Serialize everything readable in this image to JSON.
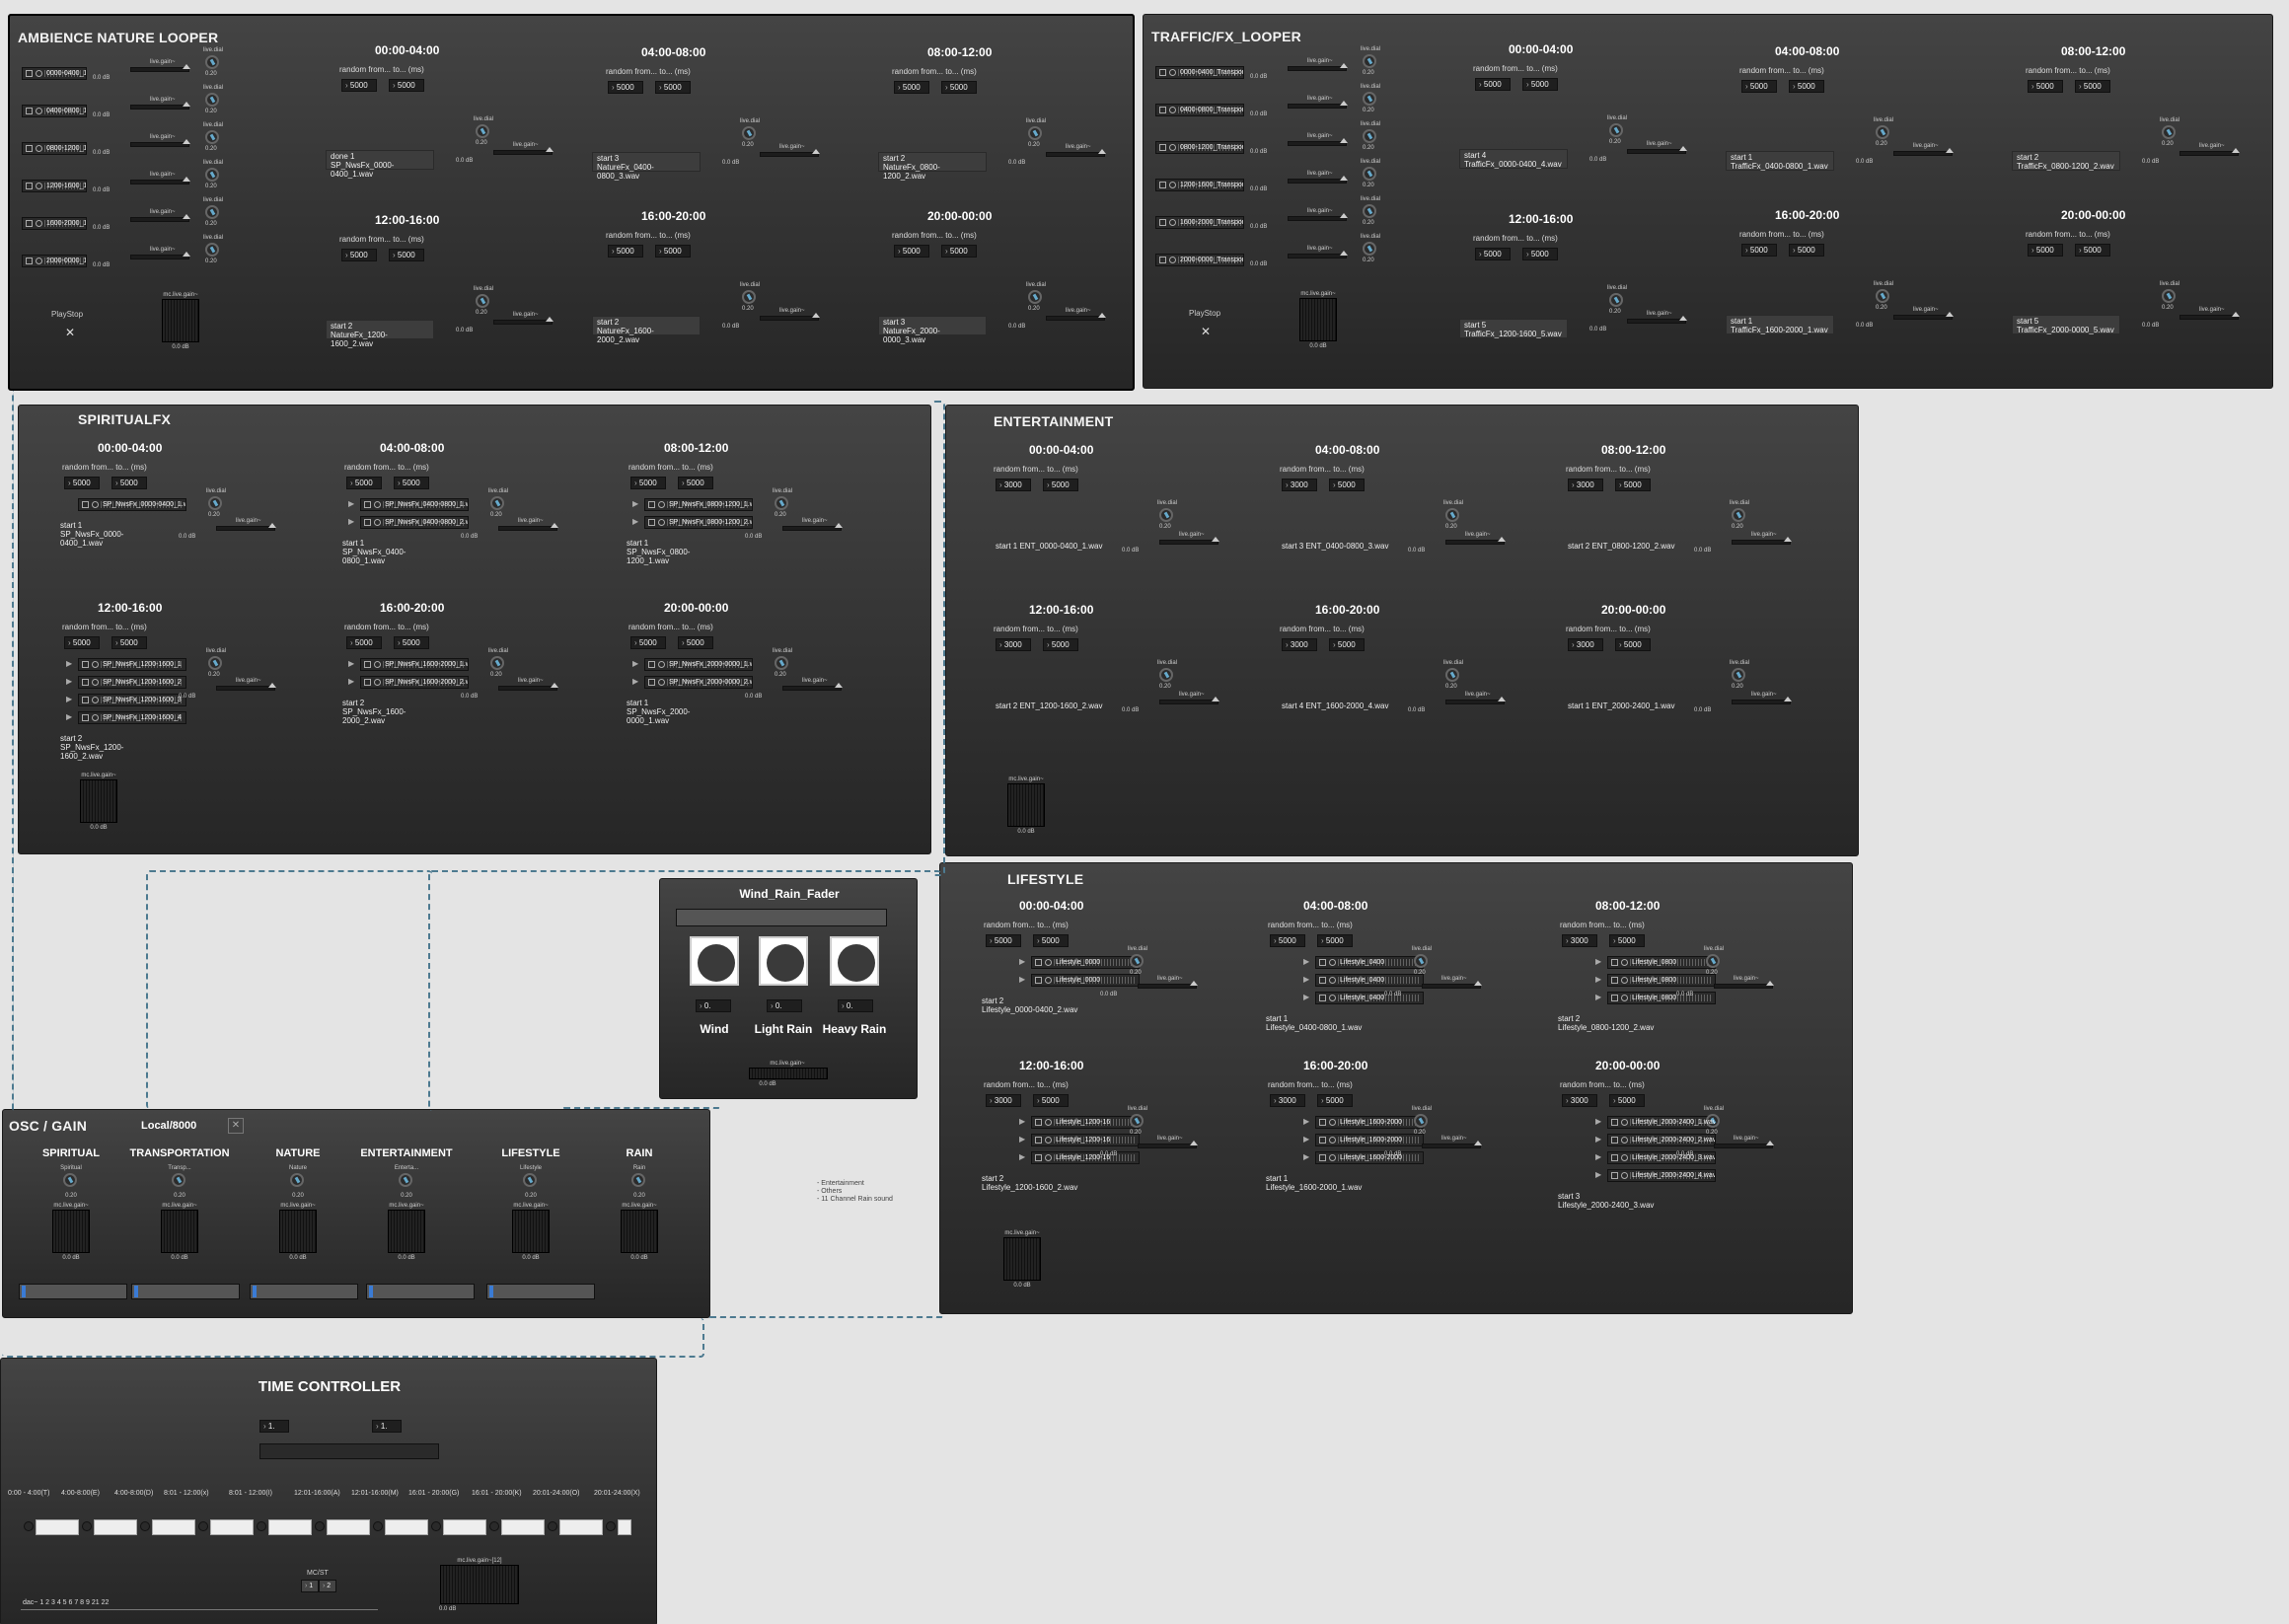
{
  "ambience": {
    "title": "AMBIENCE NATURE LOOPER",
    "play_label": "PlayStop",
    "slots": [
      {
        "time": "00:00-04:00",
        "min": "5000",
        "max": "5000",
        "status_a": "done 1",
        "status_b": "SP_NwsFx_0000-0400_1.wav"
      },
      {
        "time": "04:00-08:00",
        "min": "5000",
        "max": "5000",
        "status_a": "start 3",
        "status_b": "NatureFx_0400-0800_3.wav"
      },
      {
        "time": "08:00-12:00",
        "min": "5000",
        "max": "5000",
        "status_a": "start 2",
        "status_b": "NatureFx_0800-1200_2.wav"
      },
      {
        "time": "12:00-16:00",
        "min": "5000",
        "max": "5000",
        "status_a": "start 2",
        "status_b": "NatureFx_1200-1600_2.wav"
      },
      {
        "time": "16:00-20:00",
        "min": "5000",
        "max": "5000",
        "status_a": "start 2",
        "status_b": "NatureFx_1600-2000_2.wav"
      },
      {
        "time": "20:00-00:00",
        "min": "5000",
        "max": "5000",
        "status_a": "start 3",
        "status_b": "NatureFx_2000-0000_3.wav"
      }
    ],
    "waves": [
      "0000-0400_1",
      "0400-0800_1",
      "0800-1200_1",
      "1200-1600_1",
      "1600-2000_1",
      "2000-0000_1"
    ]
  },
  "traffic": {
    "title": "TRAFFIC/FX_LOOPER",
    "play_label": "PlayStop",
    "slots": [
      {
        "time": "00:00-04:00",
        "min": "5000",
        "max": "5000",
        "status_a": "start 4",
        "status_b": "TrafficFx_0000-0400_4.wav"
      },
      {
        "time": "04:00-08:00",
        "min": "5000",
        "max": "5000",
        "status_a": "start 1",
        "status_b": "TrafficFx_0400-0800_1.wav"
      },
      {
        "time": "08:00-12:00",
        "min": "5000",
        "max": "5000",
        "status_a": "start 2",
        "status_b": "TrafficFx_0800-1200_2.wav"
      },
      {
        "time": "12:00-16:00",
        "min": "5000",
        "max": "5000",
        "status_a": "start 5",
        "status_b": "TrafficFx_1200-1600_5.wav"
      },
      {
        "time": "16:00-20:00",
        "min": "5000",
        "max": "5000",
        "status_a": "start 1",
        "status_b": "TrafficFx_1600-2000_1.wav"
      },
      {
        "time": "20:00-00:00",
        "min": "5000",
        "max": "5000",
        "status_a": "start 5",
        "status_b": "TrafficFx_2000-0000_5.wav"
      }
    ],
    "waves": [
      "0000-0400_Transport",
      "0400-0800_Transport",
      "0800-1200_Transport",
      "1200-1600_Transport",
      "1600-2000_Transport",
      "2000-0000_Transport"
    ]
  },
  "spiritual": {
    "title": "SPIRITUALFX",
    "slots": [
      {
        "time": "00:00-04:00",
        "min": "5000",
        "max": "5000",
        "status_a": "start 1",
        "status_b": "SP_NwsFx_0000-0400_1.wav",
        "waves": [
          "SP_NwsFx_0000-0400_1.wav"
        ]
      },
      {
        "time": "04:00-08:00",
        "min": "5000",
        "max": "5000",
        "status_a": "start 1",
        "status_b": "SP_NwsFx_0400-0800_1.wav",
        "waves": [
          "SP_NwsFx_0400-0800_1.wav",
          "SP_NwsFx_0400-0800_2.wav"
        ]
      },
      {
        "time": "08:00-12:00",
        "min": "5000",
        "max": "5000",
        "status_a": "start 1",
        "status_b": "SP_NwsFx_0800-1200_1.wav",
        "waves": [
          "SP_NwsFx_0800-1200_1.wav",
          "SP_NwsFx_0800-1200_2.wav"
        ]
      },
      {
        "time": "12:00-16:00",
        "min": "5000",
        "max": "5000",
        "status_a": "start 2",
        "status_b": "SP_NwsFx_1200-1600_2.wav",
        "waves": [
          "SP_NwsFx_1200-1600_1",
          "SP_NwsFx_1200-1600_2",
          "SP_NwsFx_1200-1600_3",
          "SP_NwsFx_1200-1600_4"
        ]
      },
      {
        "time": "16:00-20:00",
        "min": "5000",
        "max": "5000",
        "status_a": "start 2",
        "status_b": "SP_NwsFx_1600-2000_2.wav",
        "waves": [
          "SP_NwsFx_1600-2000_1.wav",
          "SP_NwsFx_1600-2000_2.wav"
        ]
      },
      {
        "time": "20:00-00:00",
        "min": "5000",
        "max": "5000",
        "status_a": "start 1",
        "status_b": "SP_NwsFx_2000-0000_1.wav",
        "waves": [
          "SP_NwsFx_2000-0000_1.wav",
          "SP_NwsFx_2000-0000_2.wav"
        ]
      }
    ]
  },
  "entertainment": {
    "title": "ENTERTAINMENT",
    "slots": [
      {
        "time": "00:00-04:00",
        "min": "3000",
        "max": "5000",
        "status": "start 1 ENT_0000-0400_1.wav"
      },
      {
        "time": "04:00-08:00",
        "min": "3000",
        "max": "5000",
        "status": "start 3 ENT_0400-0800_3.wav"
      },
      {
        "time": "08:00-12:00",
        "min": "3000",
        "max": "5000",
        "status": "start 2 ENT_0800-1200_2.wav"
      },
      {
        "time": "12:00-16:00",
        "min": "3000",
        "max": "5000",
        "status": "start 2 ENT_1200-1600_2.wav"
      },
      {
        "time": "16:00-20:00",
        "min": "3000",
        "max": "5000",
        "status": "start 4 ENT_1600-2000_4.wav"
      },
      {
        "time": "20:00-00:00",
        "min": "3000",
        "max": "5000",
        "status": "start 1 ENT_2000-2400_1.wav"
      }
    ]
  },
  "lifestyle": {
    "title": "LIFESTYLE",
    "slots": [
      {
        "time": "00:00-04:00",
        "min": "5000",
        "max": "5000",
        "status_a": "start 2",
        "status_b": "Lifestyle_0000-0400_2.wav",
        "waves": [
          "Lifestyle_0000",
          "Lifestyle_0000"
        ]
      },
      {
        "time": "04:00-08:00",
        "min": "5000",
        "max": "5000",
        "status_a": "start 1",
        "status_b": "Lifestyle_0400-0800_1.wav",
        "waves": [
          "Lifestyle_0400",
          "Lifestyle_0400",
          "Lifestyle_0400"
        ]
      },
      {
        "time": "08:00-12:00",
        "min": "3000",
        "max": "5000",
        "status_a": "start 2",
        "status_b": "Lifestyle_0800-1200_2.wav",
        "waves": [
          "Lifestyle_0800",
          "Lifestyle_0800",
          "Lifestyle_0800"
        ]
      },
      {
        "time": "12:00-16:00",
        "min": "3000",
        "max": "5000",
        "status_a": "start 2",
        "status_b": "Lifestyle_1200-1600_2.wav",
        "waves": [
          "Lifestyle_1200-16",
          "Lifestyle_1200-16",
          "Lifestyle_1200-16"
        ]
      },
      {
        "time": "16:00-20:00",
        "min": "3000",
        "max": "5000",
        "status_a": "start 1",
        "status_b": "Lifestyle_1600-2000_1.wav",
        "waves": [
          "Lifestyle_1600-2000",
          "Lifestyle_1600-2000",
          "Lifestyle_1600-2000"
        ]
      },
      {
        "time": "20:00-00:00",
        "min": "3000",
        "max": "5000",
        "status_a": "start 3",
        "status_b": "Lifestyle_2000-2400_3.wav",
        "waves": [
          "Lifestyle_2000-2400_1.wav",
          "Lifestyle_2000-2400_2.wav",
          "Lifestyle_2000-2400_3.wav",
          "Lifestyle_2000-2400_4.wav"
        ]
      }
    ]
  },
  "common": {
    "random_label": "random from... to... (ms)",
    "dial_label": "live.dial",
    "dial_value": "0.20",
    "gain_label": "live.gain~",
    "gain_value": "0.0 dB",
    "mcgain_label": "mc.live.gain~"
  },
  "wind": {
    "title": "Wind_Rain_Fader",
    "labels": [
      "Wind",
      "Light Rain",
      "Heavy Rain"
    ],
    "values": [
      "0.",
      "0.",
      "0."
    ]
  },
  "osc": {
    "title": "OSC / GAIN",
    "port": "Local/8000",
    "cols": [
      {
        "h": "SPIRITUAL",
        "sub": "Spiritual"
      },
      {
        "h": "TRANSPORTATION",
        "sub": "Transp..."
      },
      {
        "h": "NATURE",
        "sub": "Nature"
      },
      {
        "h": "ENTERTAINMENT",
        "sub": "Enterta..."
      },
      {
        "h": "LIFESTYLE",
        "sub": "Lifestyle"
      },
      {
        "h": "RAIN",
        "sub": "Rain"
      }
    ]
  },
  "note": [
    "- Entertainment",
    "- Others",
    "- 11 Channel Rain sound"
  ],
  "time": {
    "title": "TIME CONTROLLER",
    "num_a": "1.",
    "num_b": "1.",
    "labels": [
      "0:00 - 4:00(T)",
      "4:00-8:00(E)",
      "4:00-8:00(D)",
      "8:01 - 12:00(x)",
      "8:01 - 12:00(I)",
      "12:01-16:00(A)",
      "12:01-16:00(M)",
      "16:01 - 20:00(G)",
      "16:01 - 20:00(K)",
      "20:01-24:00(O)",
      "20:01-24:00(X)"
    ],
    "mcst": "MC/ST",
    "mc1": "1",
    "mc2": "2",
    "mcgain": "mc.live.gain~[12]",
    "dac": "dac~ 1 2 3 4 5 6 7 8 9 21 22",
    "db": "0.0 dB"
  }
}
